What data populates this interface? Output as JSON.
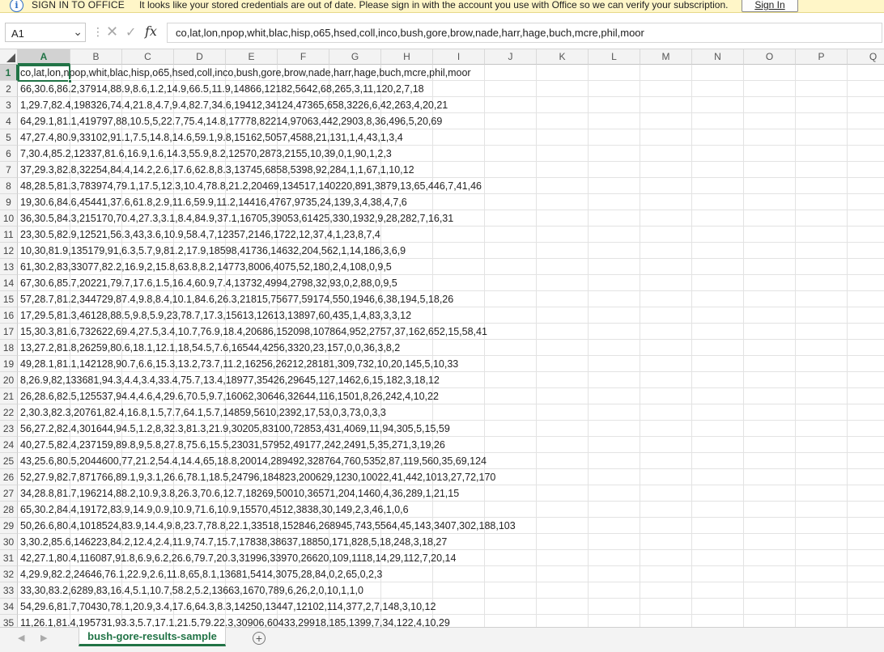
{
  "notification": {
    "icon": "info-icon",
    "title": "SIGN IN TO OFFICE",
    "message": "It looks like your stored credentials are out of date. Please sign in with the account you use with Office so we can verify your subscription.",
    "button_label": "Sign In"
  },
  "formula_bar": {
    "name_box": "A1",
    "fx_label": "fx",
    "content": "co,lat,lon,npop,whit,blac,hisp,o65,hsed,coll,inco,bush,gore,brow,nade,harr,hage,buch,mcre,phil,moor"
  },
  "columns": [
    "A",
    "B",
    "C",
    "D",
    "E",
    "F",
    "G",
    "H",
    "I",
    "J",
    "K",
    "L",
    "M",
    "N",
    "O",
    "P",
    "Q"
  ],
  "selected_column": "A",
  "rows": [
    "co,lat,lon,npop,whit,blac,hisp,o65,hsed,coll,inco,bush,gore,brow,nade,harr,hage,buch,mcre,phil,moor",
    "66,30.6,86.2,37914,88.9,8.6,1.2,14.9,66.5,11.9,14866,12182,5642,68,265,3,11,120,2,7,18",
    "1,29.7,82.4,198326,74.4,21.8,4.7,9.4,82.7,34.6,19412,34124,47365,658,3226,6,42,263,4,20,21",
    "64,29.1,81.1,419797,88,10.5,5,22.7,75.4,14.8,17778,82214,97063,442,2903,8,36,496,5,20,69",
    "47,27.4,80.9,33102,91.1,7.5,14.8,14.6,59.1,9.8,15162,5057,4588,21,131,1,4,43,1,3,4",
    "7,30.4,85.2,12337,81.6,16.9,1.6,14.3,55.9,8.2,12570,2873,2155,10,39,0,1,90,1,2,3",
    "37,29.3,82.8,32254,84.4,14.2,2.6,17.6,62.8,8.3,13745,6858,5398,92,284,1,1,67,1,10,12",
    "48,28.5,81.3,783974,79.1,17.5,12.3,10.4,78.8,21.2,20469,134517,140220,891,3879,13,65,446,7,41,46",
    "19,30.6,84.6,45441,37.6,61.8,2.9,11.6,59.9,11.2,14416,4767,9735,24,139,3,4,38,4,7,6",
    "36,30.5,84.3,215170,70.4,27.3,3.1,8.4,84.9,37.1,16705,39053,61425,330,1932,9,28,282,7,16,31",
    "23,30.5,82.9,12521,56.3,43,3.6,10.9,58.4,7,12357,2146,1722,12,37,4,1,23,8,7,4",
    "10,30,81.9,135179,91,6.3,5.7,9,81.2,17.9,18598,41736,14632,204,562,1,14,186,3,6,9",
    "61,30.2,83,33077,82.2,16.9,2,15.8,63.8,8.2,14773,8006,4075,52,180,2,4,108,0,9,5",
    "67,30.6,85.7,20221,79.7,17.6,1.5,16.4,60.9,7.4,13732,4994,2798,32,93,0,2,88,0,9,5",
    "57,28.7,81.2,344729,87.4,9.8,8.4,10.1,84.6,26.3,21815,75677,59174,550,1946,6,38,194,5,18,26",
    "17,29.5,81.3,46128,88.5,9.8,5.9,23,78.7,17.3,15613,12613,13897,60,435,1,4,83,3,3,12",
    "15,30.3,81.6,732622,69.4,27.5,3.4,10.7,76.9,18.4,20686,152098,107864,952,2757,37,162,652,15,58,41",
    "13,27.2,81.8,26259,80.6,18.1,12.1,18,54.5,7.6,16544,4256,3320,23,157,0,0,36,3,8,2",
    "49,28.1,81.1,142128,90.7,6.6,15.3,13.2,73.7,11.2,16256,26212,28181,309,732,10,20,145,5,10,33",
    "8,26.9,82,133681,94.3,4.4,3.4,33.4,75.7,13.4,18977,35426,29645,127,1462,6,15,182,3,18,12",
    "26,28.6,82.5,125537,94.4,4.6,4,29.6,70.5,9.7,16062,30646,32644,116,1501,8,26,242,4,10,22",
    "2,30.3,82.3,20761,82.4,16.8,1.5,7.7,64.1,5.7,14859,5610,2392,17,53,0,3,73,0,3,3",
    "56,27.2,82.4,301644,94.5,1.2,8,32.3,81.3,21.9,30205,83100,72853,431,4069,11,94,305,5,15,59",
    "40,27.5,82.4,237159,89.8,9,5.8,27.8,75.6,15.5,23031,57952,49177,242,2491,5,35,271,3,19,26",
    "43,25.6,80.5,2044600,77,21.2,54.4,14.4,65,18.8,20014,289492,328764,760,5352,87,119,560,35,69,124",
    "52,27.9,82.7,871766,89.1,9,3.1,26.6,78.1,18.5,24796,184823,200629,1230,10022,41,442,1013,27,72,170",
    "34,28.8,81.7,196214,88.2,10.9,3.8,26.3,70.6,12.7,18269,50010,36571,204,1460,4,36,289,1,21,15",
    "65,30.2,84.4,19172,83.9,14.9,0.9,10.9,71.6,10.9,15570,4512,3838,30,149,2,3,46,1,0,6",
    "50,26.6,80.4,1018524,83.9,14.4,9.8,23.7,78.8,22.1,33518,152846,268945,743,5564,45,143,3407,302,188,103",
    "3,30.2,85.6,146223,84.2,12.4,2.4,11.9,74.7,15.7,17838,38637,18850,171,828,5,18,248,3,18,27",
    "42,27.1,80.4,116087,91.8,6.9,6.2,26.6,79.7,20.3,31996,33970,26620,109,1118,14,29,112,7,20,14",
    "4,29.9,82.2,24646,76.1,22.9,2.6,11.8,65,8.1,13681,5414,3075,28,84,0,2,65,0,2,3",
    "33,30,83.2,6289,83,16.4,5.1,10.7,58.2,5.2,13663,1670,789,6,26,2,0,10,1,1,0",
    "54,29.6,81.7,70430,78.1,20.9,3.4,17.6,64.3,8.3,14250,13447,12102,114,377,2,7,148,3,10,12",
    "11,26.1,81.4,195731,93.3,5.7,17.1,21.5,79.22.3,30906,60433,29918,185,1399,7,34,122,4,10,29"
  ],
  "sheet_tab": "bush-gore-results-sample",
  "theme": {
    "accent": "#217346",
    "notify_bg": "#fff6c8",
    "info_icon": "#2b6cc4"
  }
}
